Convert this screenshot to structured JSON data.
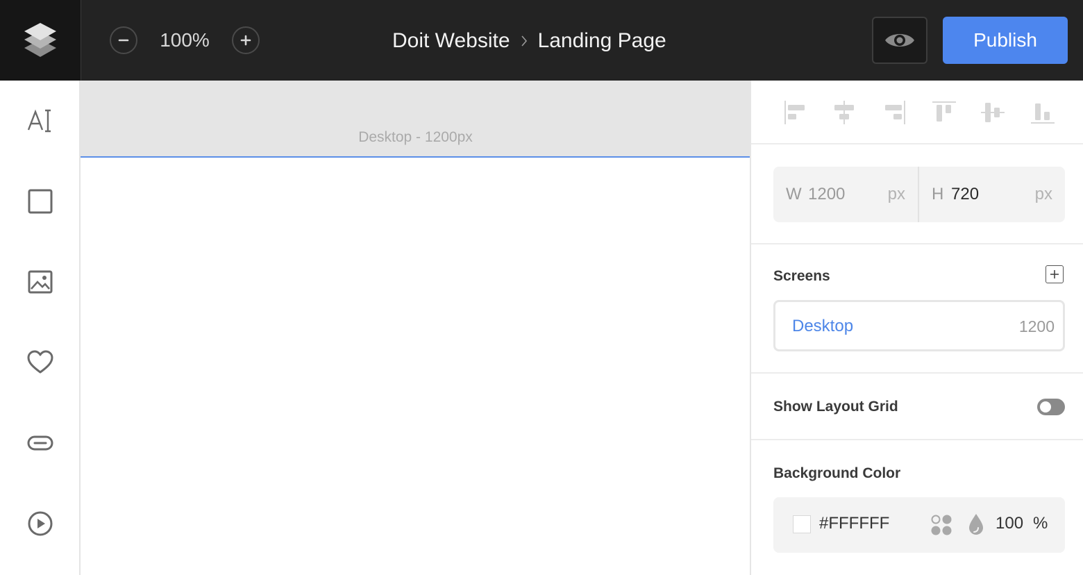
{
  "topbar": {
    "zoom_value": "100%",
    "breadcrumb": {
      "project": "Doit Website",
      "page": "Landing Page"
    },
    "publish_label": "Publish"
  },
  "left_toolbar": {
    "tools": [
      "text-tool-icon",
      "rectangle-tool-icon",
      "image-tool-icon",
      "heart-icon",
      "button-tool-icon",
      "video-tool-icon"
    ]
  },
  "canvas": {
    "frame_label": "Desktop - 1200px"
  },
  "properties": {
    "alignment": [
      "align-left-icon",
      "align-center-horizontal-icon",
      "align-right-icon",
      "align-top-icon",
      "align-middle-vertical-icon",
      "align-bottom-icon"
    ],
    "width": {
      "letter": "W",
      "value": "1200",
      "unit": "px"
    },
    "height": {
      "letter": "H",
      "value": "720",
      "unit": "px"
    },
    "screens": {
      "title": "Screens",
      "items": [
        {
          "name": "Desktop",
          "width": "1200"
        }
      ]
    },
    "layout_grid": {
      "label": "Show Layout Grid",
      "enabled": false
    },
    "background": {
      "title": "Background Color",
      "hex": "#FFFFFF",
      "opacity": "100",
      "opacity_unit": "%"
    }
  },
  "colors": {
    "topbar": "#232323",
    "accent": "#4d86ee",
    "canvas_header": "#e5e5e5"
  }
}
